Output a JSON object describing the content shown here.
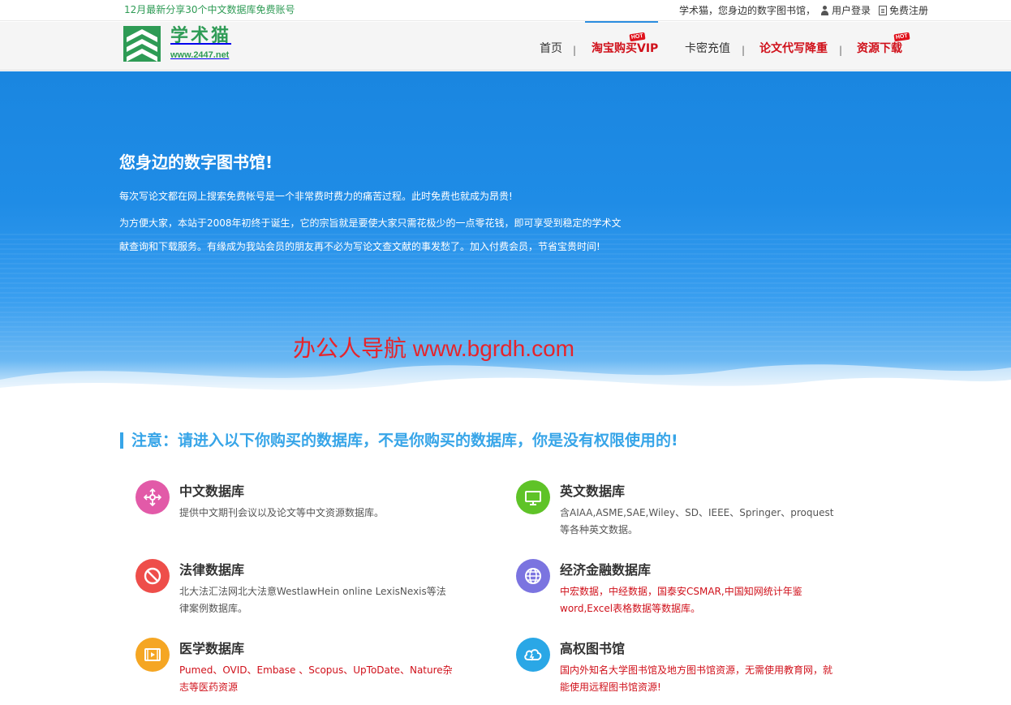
{
  "topbar": {
    "notice": "12月最新分享30个中文数据库免费账号",
    "tagline": "学术猫，您身边的数字图书馆，",
    "login": "用户登录",
    "register": "免费注册"
  },
  "logo": {
    "title": "学术猫",
    "url": "www.2447.net"
  },
  "nav": {
    "items": [
      {
        "label": "首页"
      },
      {
        "label": "淘宝购买VIP",
        "hot": "HOT"
      },
      {
        "label": "卡密充值"
      },
      {
        "label": "论文代写降重"
      },
      {
        "label": "资源下载",
        "hot": "HOT"
      }
    ],
    "separator": "|"
  },
  "banner": {
    "heading": "您身边的数字图书馆!",
    "para1": "每次写论文都在网上搜索免费帐号是一个非常费时费力的痛苦过程。此时免费也就成为昂贵!",
    "para2": "为方便大家，本站于2008年初终于诞生，它的宗旨就是要使大家只需花极少的一点零花钱，即可享受到稳定的学术文献查询和下载服务。有缘成为我站会员的朋友再不必为写论文查文献的事发愁了。加入付费会员，节省宝贵时间!",
    "watermark": "办公人导航 www.bgrdh.com"
  },
  "notice": {
    "text": "注意：请进入以下你购买的数据库，不是你购买的数据库，你是没有权限使用的!"
  },
  "databases": [
    {
      "title": "中文数据库",
      "desc": "提供中文期刊会议以及论文等中文资源数据库。",
      "icon": "network-icon",
      "color": "#e25aa8",
      "red": false
    },
    {
      "title": "英文数据库",
      "desc": "含AIAA,ASME,SAE,Wiley、SD、IEEE、Springer、proquest等各种英文数据。",
      "icon": "monitor-icon",
      "color": "#5fc328",
      "red": false
    },
    {
      "title": "法律数据库",
      "desc": "北大法汇法网北大法意WestlawHein online LexisNexis等法律案例数据库。",
      "icon": "ban-icon",
      "color": "#ee4e4a",
      "red": false
    },
    {
      "title": "经济金融数据库",
      "desc": "中宏数据，中经数据，国泰安CSMAR,中国知网统计年鉴word,Excel表格数据等数据库。",
      "icon": "globe-icon",
      "color": "#7b74e0",
      "red": true
    },
    {
      "title": "医学数据库",
      "desc": "Pumed、OVID、Embase 、Scopus、UpToDate、Nature杂志等医药资源",
      "icon": "video-icon",
      "color": "#f5a623",
      "red": true
    },
    {
      "title": "高权图书馆",
      "desc": "国内外知名大学图书馆及地方图书馆资源，无需使用教育网，就能使用远程图书馆资源!",
      "icon": "cloud-icon",
      "color": "#2aa7e6",
      "red": true
    }
  ]
}
